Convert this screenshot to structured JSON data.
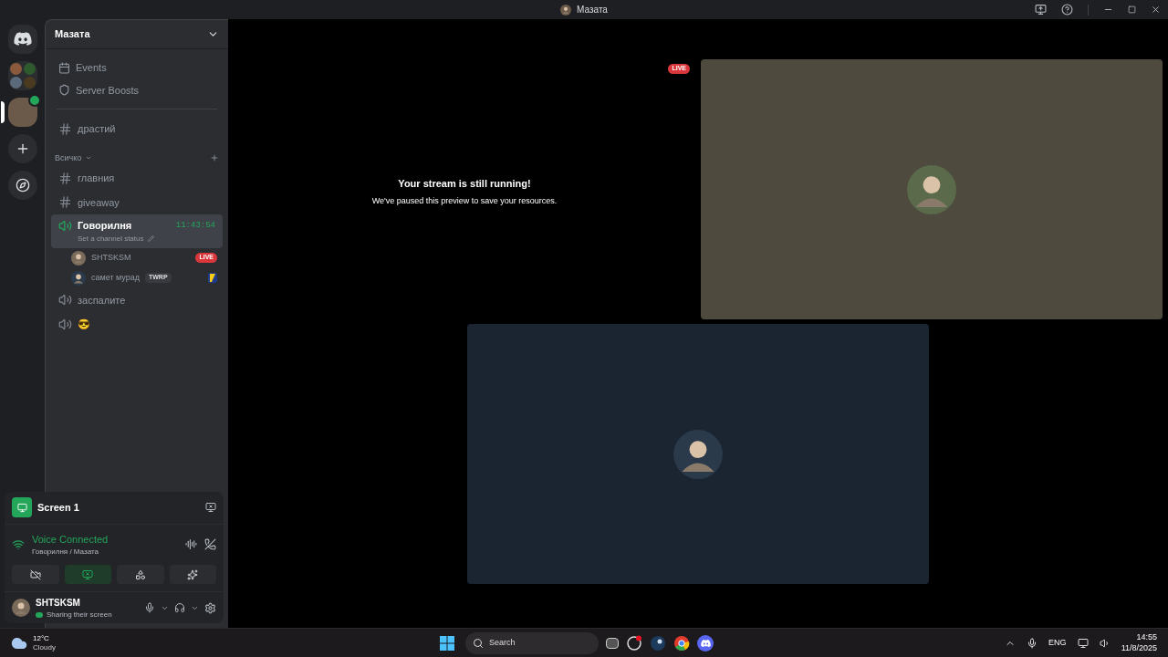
{
  "title_bar": {
    "title": "Мазата"
  },
  "server_rail": [
    {
      "kind": "home",
      "selected": false
    },
    {
      "kind": "folder",
      "selected": false
    },
    {
      "kind": "server",
      "selected": true
    },
    {
      "kind": "add",
      "selected": false
    },
    {
      "kind": "discover",
      "selected": false
    }
  ],
  "server": {
    "name": "Мазата"
  },
  "nav_items": [
    {
      "kind": "events",
      "label": "Events"
    },
    {
      "kind": "boosts",
      "label": "Server Boosts"
    }
  ],
  "top_channels": [
    {
      "kind": "text",
      "name": "драстий",
      "selected": false
    }
  ],
  "category": {
    "name": "Всичко",
    "channels": [
      {
        "kind": "text",
        "name": "главния",
        "selected": false
      },
      {
        "kind": "text",
        "name": "giveaway",
        "selected": false
      },
      {
        "kind": "voice",
        "name": "Говорилня",
        "selected": true,
        "time": "11:43:54",
        "status_hint": "Set a channel status",
        "members": [
          {
            "name": "SHTSKSM",
            "live": true,
            "live_label": "LIVE"
          },
          {
            "name": "самет мурад",
            "tag": "TWRP",
            "live": false
          }
        ]
      },
      {
        "kind": "voice",
        "name": "заспалите",
        "selected": false
      },
      {
        "kind": "voice",
        "name": "😎",
        "selected": false
      }
    ]
  },
  "screen_share": {
    "title": "Screen 1"
  },
  "voice": {
    "status": "Voice Connected",
    "location": "Говорилня / Мазата"
  },
  "voice_actions": [
    {
      "kind": "camera",
      "active": false
    },
    {
      "kind": "screen",
      "active": true
    },
    {
      "kind": "activities",
      "active": false
    },
    {
      "kind": "soundboard",
      "active": false
    }
  ],
  "user": {
    "name": "SHTSKSM",
    "status": "Sharing their screen"
  },
  "stage": {
    "paused_title": "Your stream is still running!",
    "paused_text": "We've paused this preview to save your resources.",
    "live_label": "LIVE",
    "tiles": [
      {
        "color": "#4e4b3e"
      },
      {
        "color": "#1b2532"
      }
    ]
  },
  "taskbar": {
    "temp": "12°C",
    "condition": "Cloudy",
    "search_placeholder": "Search",
    "language": "ENG",
    "time": "14:55",
    "date": "11/8/2025"
  }
}
